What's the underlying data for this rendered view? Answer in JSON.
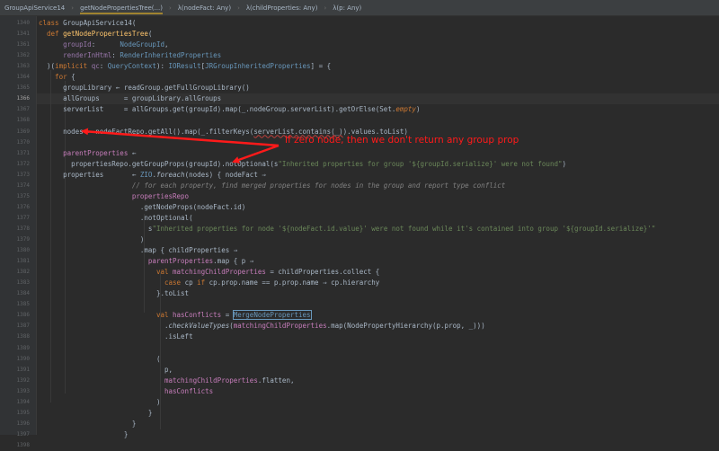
{
  "breadcrumbs": [
    {
      "label": "GroupApiService14",
      "active": false
    },
    {
      "label": "getNodePropertiesTree(...)",
      "active": true
    },
    {
      "label": "λ(nodeFact: Any)",
      "active": false
    },
    {
      "label": "λ(childProperties: Any)",
      "active": false
    },
    {
      "label": "λ(p: Any)",
      "active": false
    }
  ],
  "gutter": {
    "line_numbers": [
      "1340",
      "1341",
      "1361",
      "1362",
      "1363",
      "1364",
      "1365",
      "1366",
      "1367",
      "1368",
      "1369",
      "1370",
      "1371",
      "1372",
      "1373",
      "1374",
      "1375",
      "1376",
      "1377",
      "1378",
      "1379",
      "1380",
      "1381",
      "1382",
      "1383",
      "1384",
      "1385",
      "1386",
      "1387",
      "1388",
      "1389",
      "1390",
      "1391",
      "1392",
      "1393",
      "1394",
      "1395",
      "1396",
      "1397",
      "1398"
    ],
    "current_line": "1366"
  },
  "code_lines": [
    [
      [
        "kw",
        "class "
      ],
      [
        "cl",
        "GroupApiService14("
      ]
    ],
    [
      [
        "kw",
        "  def "
      ],
      [
        "fn",
        "getNodePropertiesTree"
      ],
      [
        "cl",
        "("
      ]
    ],
    [
      [
        "fl",
        "      groupId"
      ],
      [
        "cl",
        ":      "
      ],
      [
        "ty",
        "NodeGroupId"
      ],
      [
        "cl",
        ","
      ]
    ],
    [
      [
        "fl",
        "      renderInHtml"
      ],
      [
        "cl",
        ": "
      ],
      [
        "ty",
        "RenderInheritedProperties"
      ]
    ],
    [
      [
        "cl",
        "  )("
      ],
      [
        "kw",
        "implicit "
      ],
      [
        "fl",
        "qc"
      ],
      [
        "cl",
        ": "
      ],
      [
        "ty",
        "QueryContext"
      ],
      [
        "cl",
        "): "
      ],
      [
        "ty",
        "IOResult"
      ],
      [
        "cl",
        "["
      ],
      [
        "ty",
        "JRGroupInheritedProperties"
      ],
      [
        "cl",
        "] = {"
      ]
    ],
    [
      [
        "kw",
        "    for "
      ],
      [
        "cl",
        "{"
      ]
    ],
    [
      [
        "cl",
        "      groupLibrary ← "
      ],
      [
        "cl",
        "readGroup.getFullGroupLibrary()"
      ]
    ],
    [
      [
        "cl",
        "      allGroups      = groupLibrary.allGroups"
      ]
    ],
    [
      [
        "cl",
        "      serverList     = allGroups.get(groupId).map(_.nodeGroup.serverList).getOrElse(Set."
      ],
      [
        "kw it",
        "empty"
      ],
      [
        "cl",
        ")"
      ]
    ],
    [
      [
        "cl",
        ""
      ]
    ],
    [
      [
        "cl",
        "      nodes ← nodeFactRepo.getAll().map(_.filterKeys("
      ],
      [
        "ul",
        "serverList.contains(_)"
      ],
      [
        "cl",
        ").values.toList)"
      ]
    ],
    [
      [
        "cl",
        ""
      ]
    ],
    [
      [
        "lo",
        "      parentProperties"
      ],
      [
        "cl",
        " ←"
      ]
    ],
    [
      [
        "cl",
        "        propertiesRepo.getGroupProps(groupId).notOptional(s"
      ],
      [
        "st",
        "\"Inherited properties for group '${groupId.serialize}' were not found\""
      ],
      [
        "cl",
        ")"
      ]
    ],
    [
      [
        "cl",
        "      properties       ← "
      ],
      [
        "ty",
        "ZIO"
      ],
      [
        "cl",
        "."
      ],
      [
        "it",
        "foreach"
      ],
      [
        "cl",
        "(nodes) { nodeFact ⇒"
      ]
    ],
    [
      [
        "cm",
        "                       // for each property, find merged properties for nodes in the group and report type conflict"
      ]
    ],
    [
      [
        "lo",
        "                       propertiesRepo"
      ]
    ],
    [
      [
        "cl",
        "                         .getNodeProps(nodeFact.id)"
      ]
    ],
    [
      [
        "cl",
        "                         .notOptional("
      ]
    ],
    [
      [
        "cl",
        "                           s"
      ],
      [
        "st",
        "\"Inherited properties for node '${nodeFact.id.value}' were not found while it's contained into group '${groupId.serialize}'\""
      ]
    ],
    [
      [
        "cl",
        "                         )"
      ]
    ],
    [
      [
        "cl",
        "                         .map { childProperties ⇒"
      ]
    ],
    [
      [
        "lo",
        "                           parentProperties"
      ],
      [
        "cl",
        ".map { p ⇒"
      ]
    ],
    [
      [
        "kw",
        "                             val "
      ],
      [
        "lo",
        "matchingChildProperties"
      ],
      [
        "cl",
        " = childProperties.collect {"
      ]
    ],
    [
      [
        "kw",
        "                               case "
      ],
      [
        "cl",
        "cp "
      ],
      [
        "kw",
        "if "
      ],
      [
        "cl",
        "cp.prop.name == p.prop.name ⇒ cp.hierarchy"
      ]
    ],
    [
      [
        "cl",
        "                             }.toList"
      ]
    ],
    [
      [
        "cl",
        ""
      ]
    ],
    [
      [
        "kw",
        "                             val "
      ],
      [
        "lo",
        "hasConflicts"
      ],
      [
        "cl",
        " = "
      ],
      [
        "ty boxed",
        "MergeNodeProperties"
      ]
    ],
    [
      [
        "cl",
        "                               ."
      ],
      [
        "it",
        "checkValueTypes"
      ],
      [
        "cl",
        "("
      ],
      [
        "lo",
        "matchingChildProperties"
      ],
      [
        "cl",
        ".map(NodePropertyHierarchy(p.prop, _)))"
      ]
    ],
    [
      [
        "cl",
        "                               .isLeft"
      ]
    ],
    [
      [
        "cl",
        ""
      ]
    ],
    [
      [
        "cl",
        "                             ("
      ]
    ],
    [
      [
        "cl",
        "                               p,"
      ]
    ],
    [
      [
        "lo",
        "                               matchingChildProperties"
      ],
      [
        "cl",
        ".flatten,"
      ]
    ],
    [
      [
        "lo",
        "                               hasConflicts"
      ]
    ],
    [
      [
        "cl",
        "                             )"
      ]
    ],
    [
      [
        "cl",
        "                           }"
      ]
    ],
    [
      [
        "cl",
        "                       }"
      ]
    ],
    [
      [
        "cl",
        "                     }"
      ]
    ],
    [
      [
        "cl",
        ""
      ]
    ]
  ],
  "annotation": {
    "text": "If zero node, then we don't return any group prop"
  }
}
